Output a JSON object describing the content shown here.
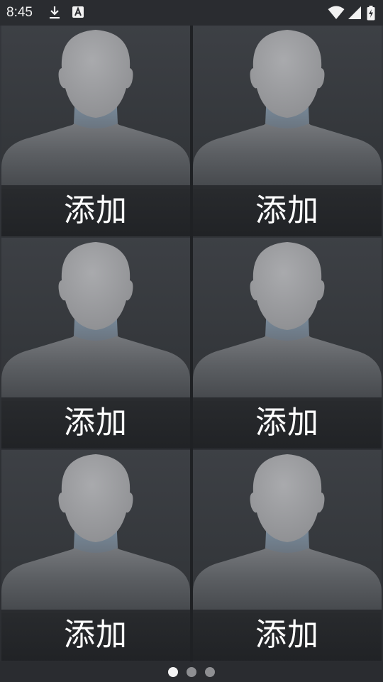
{
  "status_bar": {
    "time": "8:45",
    "icons": [
      "download-icon",
      "a-icon",
      "wifi-icon",
      "signal-icon",
      "battery-charging-icon"
    ]
  },
  "tiles": [
    {
      "label": "添加",
      "icon": "person-silhouette-icon"
    },
    {
      "label": "添加",
      "icon": "person-silhouette-icon"
    },
    {
      "label": "添加",
      "icon": "person-silhouette-icon"
    },
    {
      "label": "添加",
      "icon": "person-silhouette-icon"
    },
    {
      "label": "添加",
      "icon": "person-silhouette-icon"
    },
    {
      "label": "添加",
      "icon": "person-silhouette-icon"
    }
  ],
  "pager": {
    "page_count": 3,
    "current_page": 1
  },
  "colors": {
    "text": "#ffffff",
    "dot_active": "#f4f4f4",
    "dot_inactive": "#8e8f92"
  }
}
